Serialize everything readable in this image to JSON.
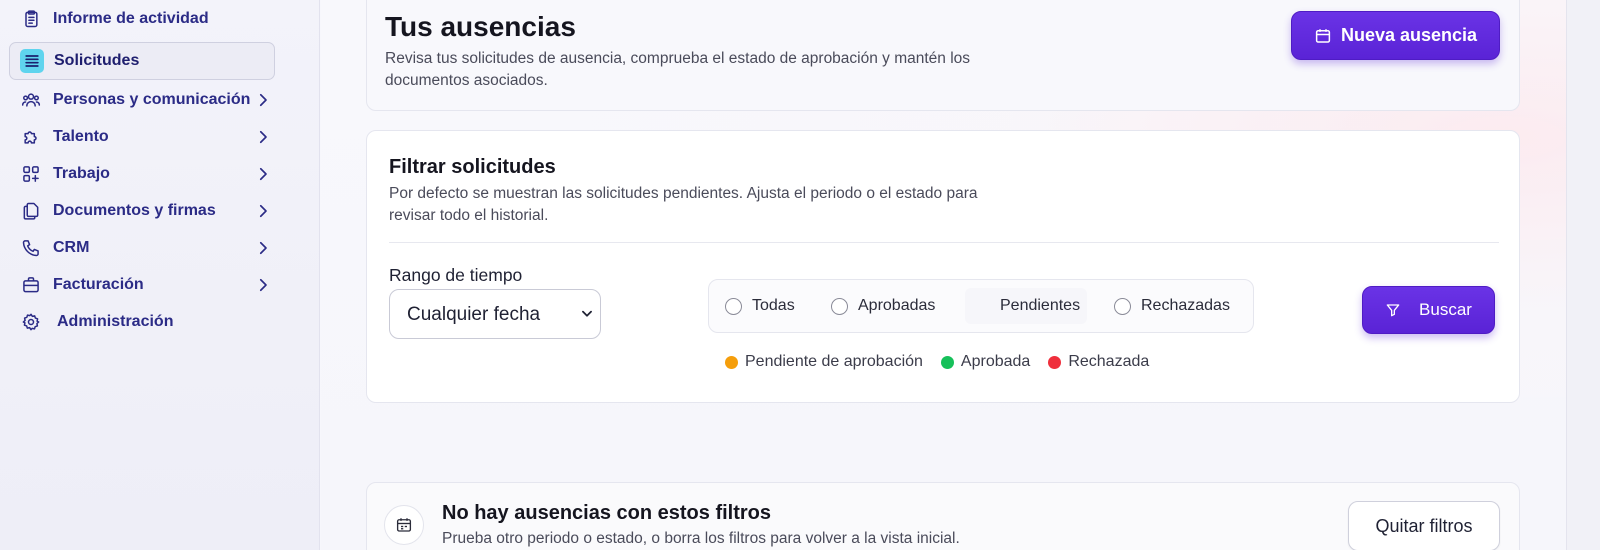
{
  "sidebar": {
    "items": [
      {
        "label": "Informe de actividad",
        "icon": "clipboard-icon",
        "has_submenu": false,
        "active": false
      },
      {
        "label": "Solicitudes",
        "icon": "list-icon",
        "has_submenu": false,
        "active": true
      },
      {
        "label": "Personas y comunicación",
        "icon": "users-icon",
        "has_submenu": true,
        "active": false
      },
      {
        "label": "Talento",
        "icon": "puzzle-icon",
        "has_submenu": true,
        "active": false
      },
      {
        "label": "Trabajo",
        "icon": "grid-plus-icon",
        "has_submenu": true,
        "active": false
      },
      {
        "label": "Documentos y firmas",
        "icon": "documents-icon",
        "has_submenu": true,
        "active": false
      },
      {
        "label": "CRM",
        "icon": "phone-icon",
        "has_submenu": true,
        "active": false
      },
      {
        "label": "Facturación",
        "icon": "briefcase-icon",
        "has_submenu": true,
        "active": false
      },
      {
        "label": "Administración",
        "icon": "gear-icon",
        "has_submenu": false,
        "active": false
      }
    ]
  },
  "header": {
    "title": "Tus ausencias",
    "description": "Revisa tus solicitudes de ausencia, comprueba el estado de aprobación y mantén los documentos asociados.",
    "new_button_label": "Nueva ausencia"
  },
  "filters": {
    "title": "Filtrar solicitudes",
    "description": "Por defecto se muestran las solicitudes pendientes. Ajusta el periodo o el estado para revisar todo el historial.",
    "range_label": "Rango de tiempo",
    "range_value": "Cualquier fecha",
    "status_options": [
      {
        "label": "Todas",
        "selected": false
      },
      {
        "label": "Aprobadas",
        "selected": false
      },
      {
        "label": "Pendientes",
        "selected": true
      },
      {
        "label": "Rechazadas",
        "selected": false
      }
    ],
    "search_label": "Buscar",
    "legend": [
      {
        "label": "Pendiente de aprobación",
        "color": "#f59e0b"
      },
      {
        "label": "Aprobada",
        "color": "#16c05a"
      },
      {
        "label": "Rechazada",
        "color": "#ef2f3c"
      }
    ]
  },
  "empty_state": {
    "title": "No hay ausencias con estos filtros",
    "description": "Prueba otro periodo o estado, o borra los filtros para volver a la vista inicial.",
    "clear_button_label": "Quitar filtros",
    "icon": "calendar-icon"
  },
  "colors": {
    "accent": "#5b24d8",
    "nav_text": "#2b2b86",
    "active_icon_bg": "#5fd4ee"
  }
}
